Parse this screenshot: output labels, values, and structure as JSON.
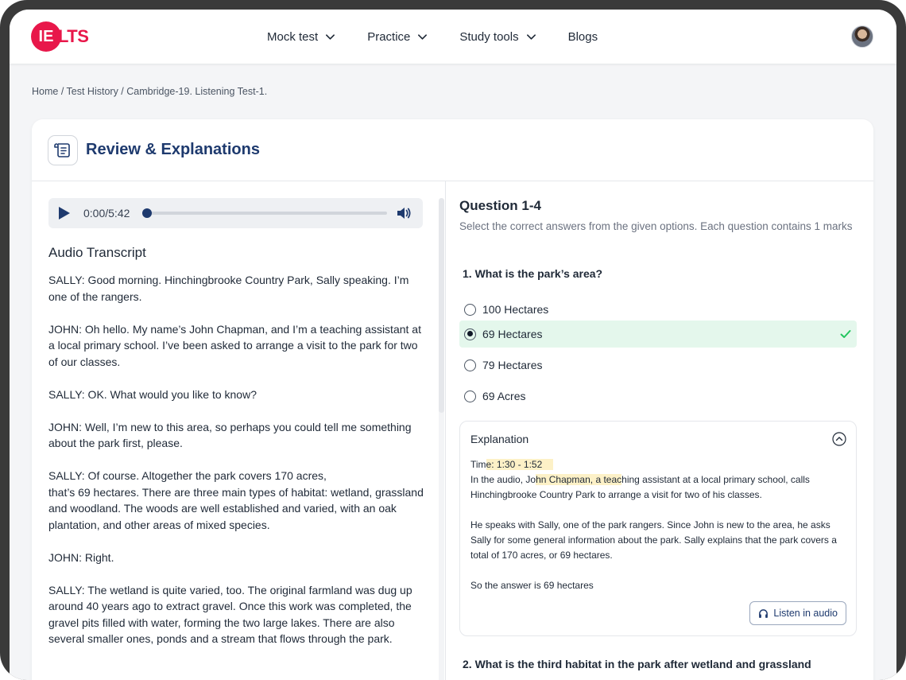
{
  "header": {
    "logo_circle": "IE",
    "logo_rest": "LTS",
    "nav": [
      {
        "label": "Mock test",
        "has_dropdown": true
      },
      {
        "label": "Practice",
        "has_dropdown": true
      },
      {
        "label": "Study tools",
        "has_dropdown": true
      },
      {
        "label": "Blogs",
        "has_dropdown": false
      }
    ]
  },
  "breadcrumb": "Home / Test History / Cambridge-19. Listening Test-1.",
  "card": {
    "title": "Review & Explanations"
  },
  "player": {
    "time": "0:00/5:42",
    "progress": 0
  },
  "transcript": {
    "title": "Audio Transcript",
    "paragraphs": [
      "SALLY:   Good morning. Hinchingbrooke Country Park, Sally speaking. I’m one of the rangers.",
      "JOHN:   Oh hello. My name’s John Chapman, and I’m a teaching assistant at a local primary school. I’ve been asked to arrange a visit to the park for two of our classes.",
      "SALLY:   OK. What would you like to know?",
      "JOHN:   Well, I’m new to this area, so perhaps you could tell me something about the park first, please.",
      "SALLY:   Of course. Altogether the park covers 170 acres,\nthat’s 69 hectares. There are three main types of habitat: wetland, grassland and woodland. The woods are well established and varied, with an oak plantation, and other areas of mixed species.",
      "JOHN:   Right.",
      "SALLY:   The wetland is quite varied, too. The original farmland was dug up around 40 years ago to extract gravel. Once this work was completed, the gravel pits filled with water, forming the two large lakes. There are also several smaller ones, ponds and a stream that flows through the park."
    ]
  },
  "questions": {
    "heading": "Question 1-4",
    "instruction": "Select the correct answers from the given options. Each question contains 1 marks",
    "q1": {
      "text": "1. What is the park’s area?",
      "options": [
        "100 Hectares",
        "69 Hectares",
        "79 Hectares",
        "69 Acres"
      ],
      "selected_index": 1,
      "correct_index": 1
    },
    "explanation": {
      "title": "Explanation",
      "time_prefix": "Tim",
      "time_hl": "e: 1:30 - 1:52",
      "line1_a": "In the audio, Jo",
      "line1_hl": "hn Chapman, a teac",
      "line1_b": "hing assistant at a local primary school, calls Hinchingbrooke Country Park to arrange a visit for two of his classes.",
      "para2": "He speaks with Sally, one of the park rangers. Since John is new to the area, he asks Sally for some general information about the park. Sally explains that the park covers a total of 170 acres, or 69 hectares.",
      "para3": "So the answer is 69 hectares",
      "listen_label": "Listen in audio"
    },
    "q2": {
      "text": "2. What is the third habitat in the park after wetland and grassland"
    }
  },
  "colors": {
    "brand": "#e8174a",
    "title": "#1e3a6e",
    "correct_bg": "#e4f7ec",
    "check": "#22c55e",
    "highlight": "#fdf1c7"
  }
}
